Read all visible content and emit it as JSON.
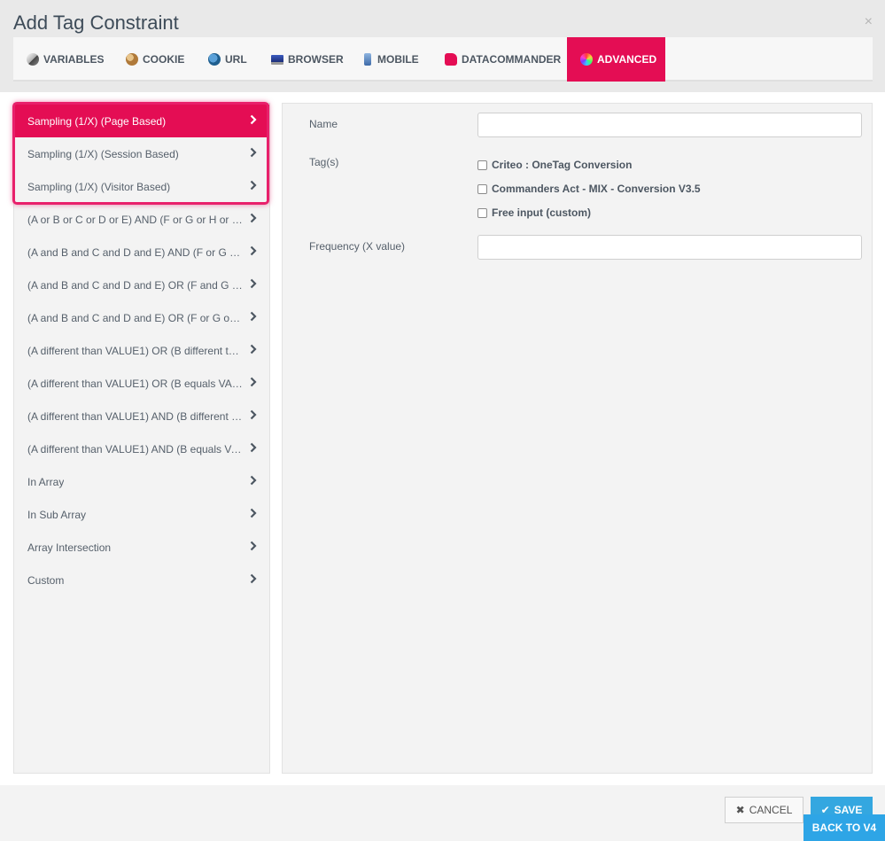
{
  "dialog": {
    "title": "Add Tag Constraint",
    "close_glyph": "×"
  },
  "tabs": [
    {
      "label": "VARIABLES",
      "icon": "variables-icon",
      "active": false
    },
    {
      "label": "COOKIE",
      "icon": "cookie-icon",
      "active": false
    },
    {
      "label": "URL",
      "icon": "globe-icon",
      "active": false
    },
    {
      "label": "BROWSER",
      "icon": "monitor-icon",
      "active": false
    },
    {
      "label": "MOBILE",
      "icon": "mobile-icon",
      "active": false
    },
    {
      "label": "DATACOMMANDER",
      "icon": "thumbs-up-icon",
      "active": false
    },
    {
      "label": "ADVANCED",
      "icon": "color-wheel-icon",
      "active": true
    }
  ],
  "constraints": [
    {
      "label": "Sampling (1/X) (Page Based)",
      "active": true
    },
    {
      "label": "Sampling (1/X) (Session Based)",
      "active": false
    },
    {
      "label": "Sampling (1/X) (Visitor Based)",
      "active": false
    },
    {
      "label": "(A or B or C or D or E) AND (F or G or H or I o...",
      "active": false
    },
    {
      "label": "(A and B and C and D and E) AND (F or G or ...",
      "active": false
    },
    {
      "label": "(A and B and C and D and E) OR (F and G an...",
      "active": false
    },
    {
      "label": "(A and B and C and D and E) OR (F or G or H ...",
      "active": false
    },
    {
      "label": "(A different than VALUE1) OR (B different tha...",
      "active": false
    },
    {
      "label": "(A different than VALUE1) OR (B equals VAL...",
      "active": false
    },
    {
      "label": "(A different than VALUE1) AND (B different t...",
      "active": false
    },
    {
      "label": "(A different than VALUE1) AND (B equals VA...",
      "active": false
    },
    {
      "label": "In Array",
      "active": false
    },
    {
      "label": "In Sub Array",
      "active": false
    },
    {
      "label": "Array Intersection",
      "active": false
    },
    {
      "label": "Custom",
      "active": false
    }
  ],
  "form": {
    "name_label": "Name",
    "name_value": "",
    "tags_label": "Tag(s)",
    "tags": [
      {
        "label": "Criteo : OneTag Conversion",
        "checked": false
      },
      {
        "label": "Commanders Act - MIX - Conversion V3.5",
        "checked": false
      },
      {
        "label": "Free input (custom)",
        "checked": false
      }
    ],
    "frequency_label": "Frequency (X value)",
    "frequency_value": ""
  },
  "footer": {
    "cancel_label": "CANCEL",
    "save_label": "SAVE",
    "back_label": "BACK TO V4"
  },
  "colors": {
    "accent": "#e40d54",
    "primary_button": "#34a7e0"
  }
}
